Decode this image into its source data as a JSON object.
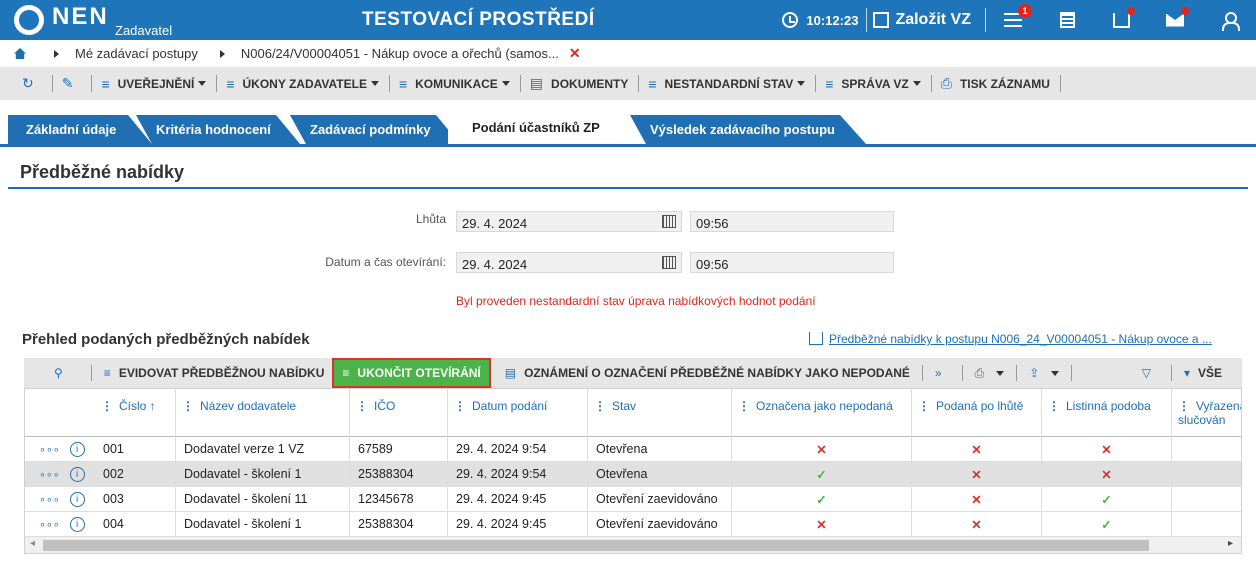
{
  "header": {
    "logo": "NEN",
    "logo_sub": "Zadavatel",
    "env_title": "TESTOVACÍ PROSTŘEDÍ",
    "time": "10:12:23",
    "create_label": "Založit VZ",
    "notif_count": "1"
  },
  "breadcrumb": {
    "item1": "Mé zadávací postupy",
    "item2": "N006/24/V00004051 - Nákup ovoce a ořechů (samos..."
  },
  "toolbar": {
    "publish": "UVEŘEJNĚNÍ",
    "actions": "ÚKONY ZADAVATELE",
    "communication": "KOMUNIKACE",
    "documents": "DOKUMENTY",
    "nonstandard": "NESTANDARDNÍ STAV",
    "manage": "SPRÁVA VZ",
    "print": "TISK ZÁZNAMU"
  },
  "tabs": [
    {
      "label": "Základní údaje"
    },
    {
      "label": "Kritéria hodnocení"
    },
    {
      "label": "Zadávací podmínky"
    },
    {
      "label": "Podání účastníků ZP"
    },
    {
      "label": "Výsledek zadávacího postupu"
    }
  ],
  "section": {
    "title": "Předběžné nabídky",
    "deadline_label": "Lhůta",
    "deadline_date": "29. 4. 2024",
    "deadline_time": "09:56",
    "opening_label": "Datum a čas otevírání:",
    "opening_date": "29. 4. 2024",
    "opening_time": "09:56",
    "warning": "Byl proveden nestandardní stav úprava nabídkových hodnot podání"
  },
  "overview": {
    "title": "Přehled podaných předběžných nabídek",
    "download_link": "Předběžné nabídky k postupu N006_24_V00004051 - Nákup ovoce a ..."
  },
  "grid_toolbar": {
    "record": "EVIDOVAT PŘEDBĚŽNOU NABÍDKU",
    "finish": "UKONČIT OTEVÍRÁNÍ",
    "notify": "OZNÁMENÍ O OZNAČENÍ PŘEDBĚŽNÉ NABÍDKY JAKO NEPODANÉ",
    "all": "VŠE"
  },
  "grid": {
    "columns": [
      "Číslo",
      "Název dodavatele",
      "IČO",
      "Datum podání",
      "Stav",
      "Označena jako nepodaná",
      "Podaná po lhůtě",
      "Listinná podoba",
      "Vyřazena slučován"
    ],
    "rows": [
      {
        "num": "001",
        "name": "Dodavatel verze 1 VZ",
        "ico": "67589",
        "date": "29. 4. 2024 9:54",
        "state": "Otevřena",
        "nepodana": "x",
        "po_lhute": "x",
        "listinna": "x"
      },
      {
        "num": "002",
        "name": "Dodavatel - školení 1",
        "ico": "25388304",
        "date": "29. 4. 2024 9:54",
        "state": "Otevřena",
        "nepodana": "check",
        "po_lhute": "x",
        "listinna": "x"
      },
      {
        "num": "003",
        "name": "Dodavatel - školení 11",
        "ico": "12345678",
        "date": "29. 4. 2024 9:45",
        "state": "Otevření zaevidováno",
        "nepodana": "check",
        "po_lhute": "x",
        "listinna": "check"
      },
      {
        "num": "004",
        "name": "Dodavatel - školení 1",
        "ico": "25388304",
        "date": "29. 4. 2024 9:45",
        "state": "Otevření zaevidováno",
        "nepodana": "x",
        "po_lhute": "x",
        "listinna": "check"
      }
    ]
  },
  "colors": {
    "primary": "#1f75b9",
    "success": "#4bb449",
    "danger": "#e4231b"
  }
}
